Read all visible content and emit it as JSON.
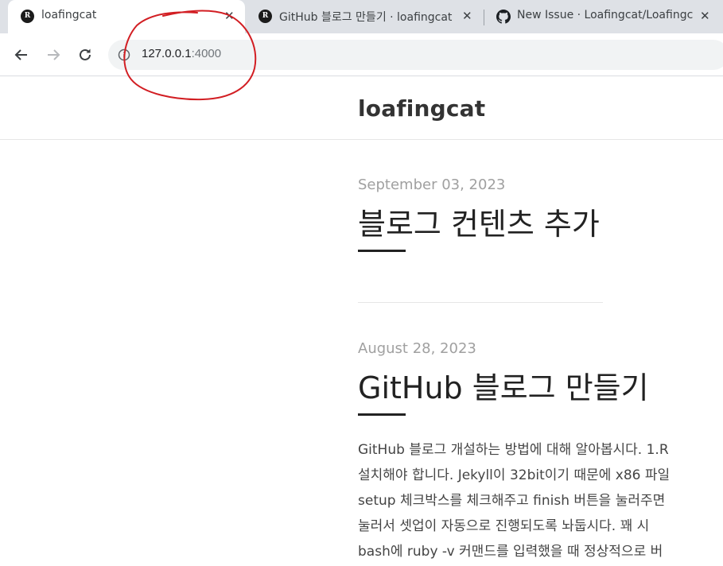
{
  "browser": {
    "tabs": [
      {
        "title": "loafingcat",
        "favicon": "loafingcat-favicon-icon",
        "active": true
      },
      {
        "title": "GitHub 블로그 만들기 · loafingcat",
        "favicon": "loafingcat-favicon-icon",
        "active": false
      },
      {
        "title": "New Issue · Loafingcat/Loafingcat",
        "favicon": "github-icon",
        "active": false
      }
    ],
    "address": {
      "host": "127.0.0.1",
      "port": ":4000"
    }
  },
  "site": {
    "title": "loafingcat"
  },
  "posts": [
    {
      "date": "September 03, 2023",
      "title": "블로그 컨텐츠 추가"
    },
    {
      "date": "August 28, 2023",
      "title": "GitHub 블로그 만들기",
      "excerpt_lines": [
        "GitHub 블로그 개설하는 방법에 대해 알아봅시다. 1.R",
        "설치해야 합니다. Jekyll이 32bit이기 때문에 x86 파일",
        "setup 체크박스를 체크해주고 finish 버튼을 눌러주면",
        "눌러서 셋업이 자동으로 진행되도록 놔둡시다. 꽤 시",
        "bash에 ruby -v 커맨드를 입력했을 때 정상적으로 버"
      ]
    }
  ],
  "colors": {
    "annotation": "#d21e23",
    "tabstrip": "#dee1e6",
    "omnibox": "#f1f3f4"
  }
}
